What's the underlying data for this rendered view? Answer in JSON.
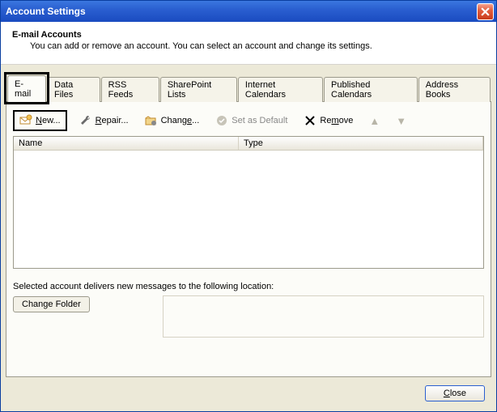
{
  "window": {
    "title": "Account Settings"
  },
  "header": {
    "title": "E-mail Accounts",
    "description": "You can add or remove an account. You can select an account and change its settings."
  },
  "tabs": [
    {
      "label": "E-mail",
      "active": true,
      "highlighted": true
    },
    {
      "label": "Data Files",
      "active": false
    },
    {
      "label": "RSS Feeds",
      "active": false
    },
    {
      "label": "SharePoint Lists",
      "active": false
    },
    {
      "label": "Internet Calendars",
      "active": false
    },
    {
      "label": "Published Calendars",
      "active": false
    },
    {
      "label": "Address Books",
      "active": false
    }
  ],
  "toolbar": {
    "new": {
      "pre": "",
      "hot": "N",
      "post": "ew...",
      "highlighted": true
    },
    "repair": {
      "pre": "",
      "hot": "R",
      "post": "epair..."
    },
    "change": {
      "pre": "Chang",
      "hot": "e",
      "post": "..."
    },
    "setDefault": {
      "label": "Set as Default",
      "disabled": true
    },
    "remove": {
      "pre": "Re",
      "hot": "m",
      "post": "ove"
    }
  },
  "list": {
    "columns": {
      "name": "Name",
      "type": "Type"
    },
    "rows": []
  },
  "location": {
    "text": "Selected account delivers new messages to the following location:",
    "changeFolder": "Change Folder"
  },
  "footer": {
    "close": {
      "hot": "C",
      "post": "lose"
    }
  }
}
